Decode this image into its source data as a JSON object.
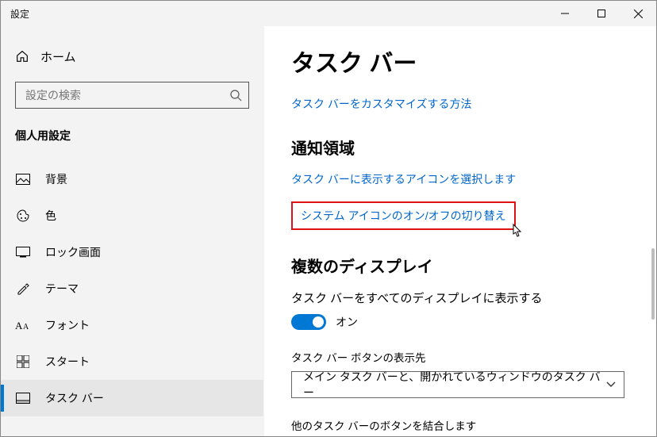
{
  "window": {
    "title": "設定"
  },
  "sidebar": {
    "home": "ホーム",
    "search_placeholder": "設定の検索",
    "section": "個人用設定",
    "items": [
      {
        "label": "背景"
      },
      {
        "label": "色"
      },
      {
        "label": "ロック画面"
      },
      {
        "label": "テーマ"
      },
      {
        "label": "フォント"
      },
      {
        "label": "スタート"
      },
      {
        "label": "タスク バー"
      }
    ]
  },
  "main": {
    "title": "タスク バー",
    "customize_link": "タスク バーをカスタマイズする方法",
    "notification_area": {
      "heading": "通知領域",
      "link_select_icons": "タスク バーに表示するアイコンを選択します",
      "link_toggle_system_icons": "システム アイコンのオン/オフの切り替え"
    },
    "multi_display": {
      "heading": "複数のディスプレイ",
      "show_all_label": "タスク バーをすべてのディスプレイに表示する",
      "toggle_state": "オン",
      "buttons_label": "タスク バー ボタンの表示先",
      "buttons_value": "メイン タスク バーと、開かれているウィンドウのタスク バー",
      "combine_label": "他のタスク バーのボタンを結合します"
    }
  }
}
